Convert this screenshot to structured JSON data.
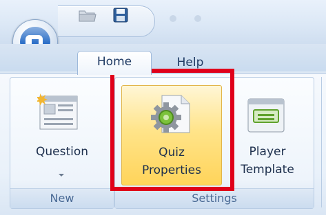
{
  "window": {
    "title": ""
  },
  "tabs": [
    {
      "label": "Home",
      "selected": true
    },
    {
      "label": "Help",
      "selected": false
    }
  ],
  "ribbon": {
    "groups": [
      {
        "label": "New",
        "buttons": [
          {
            "label_line1": "Question",
            "has_dropdown": true
          }
        ]
      },
      {
        "label": "Settings",
        "buttons": [
          {
            "label_line1": "Quiz",
            "label_line2": "Properties",
            "highlighted": true
          },
          {
            "label_line1": "Player",
            "label_line2": "Template"
          }
        ]
      }
    ]
  },
  "colors": {
    "highlight": "#e0001a",
    "accent": "#ffd45a",
    "ribbon_bg": "#e9f1fa"
  },
  "icons": {
    "orb": "app-orb-q-icon",
    "folder": "open-folder-icon",
    "save": "save-disk-icon"
  }
}
